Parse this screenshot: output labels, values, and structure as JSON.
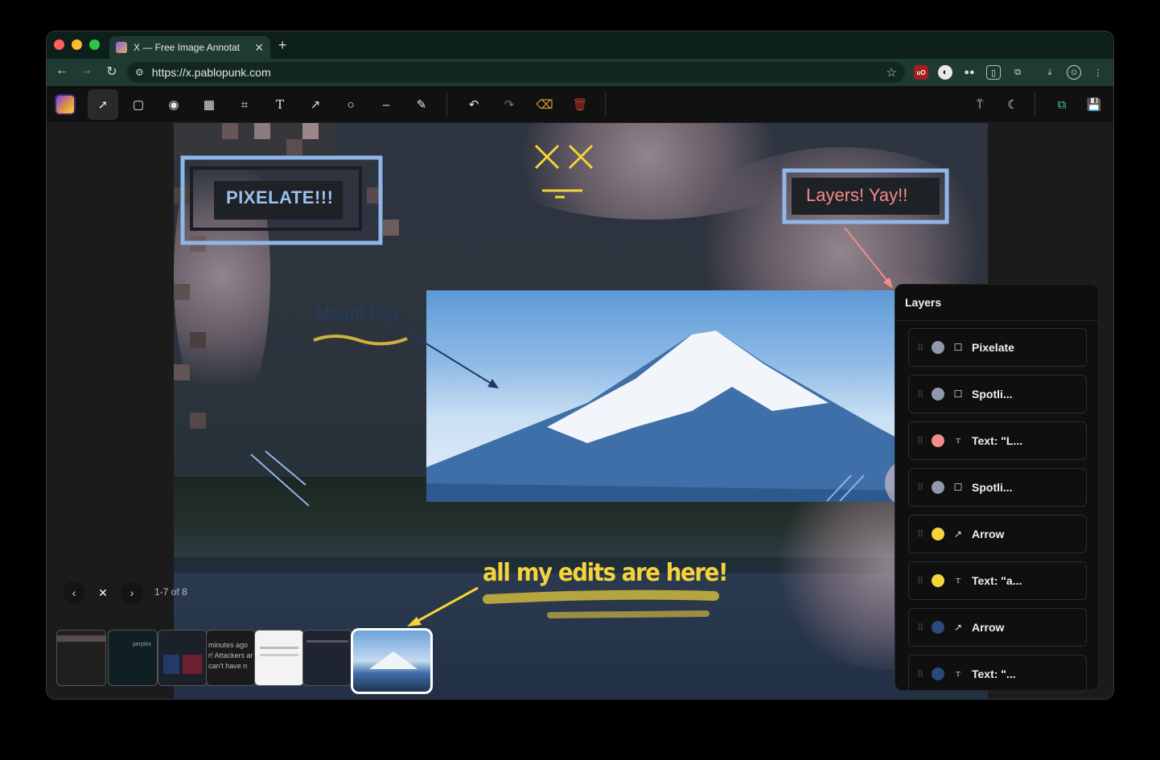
{
  "browser": {
    "tab_title": "X — Free Image Annotat",
    "tab_close": "✕",
    "new_tab": "+",
    "url": "https://x.pablopunk.com"
  },
  "annotations": {
    "pixelate_label": "PIXELATE!!!",
    "layers_label": "Layers! Yay!!",
    "mount_fuji_label": "Mount Fuji",
    "edits_label": "all my edits are here!",
    "xx_label": "X X"
  },
  "pager": {
    "count": "1-7 of 8"
  },
  "thumbnails": [
    {
      "snippet": ""
    },
    {
      "snippet": "perplex"
    },
    {
      "snippet": ""
    },
    {
      "snippet": "minutes ago\nr! Attackers ar\ncan't have n"
    },
    {
      "snippet": ""
    },
    {
      "snippet": ""
    },
    {
      "snippet": ""
    }
  ],
  "layers": {
    "title": "Layers",
    "items": [
      {
        "color": "#8e99ab",
        "type": "rect",
        "name": "Pixelate"
      },
      {
        "color": "#8e99ab",
        "type": "rect",
        "name": "Spotli..."
      },
      {
        "color": "#f38b8b",
        "type": "text",
        "name": "Text: \"L..."
      },
      {
        "color": "#8e99ab",
        "type": "rect",
        "name": "Spotli..."
      },
      {
        "color": "#f5d33a",
        "type": "arrow",
        "name": "Arrow"
      },
      {
        "color": "#f5d33a",
        "type": "text",
        "name": "Text: \"a..."
      },
      {
        "color": "#2a4a7c",
        "type": "arrow",
        "name": "Arrow"
      },
      {
        "color": "#2a4a7c",
        "type": "text",
        "name": "Text: \"..."
      }
    ]
  },
  "colors": {
    "accent_yellow": "#f5d33a",
    "accent_pink": "#f38b8b",
    "accent_blue_frame": "#8fb6e8",
    "save_green": "#3ccf8e"
  }
}
